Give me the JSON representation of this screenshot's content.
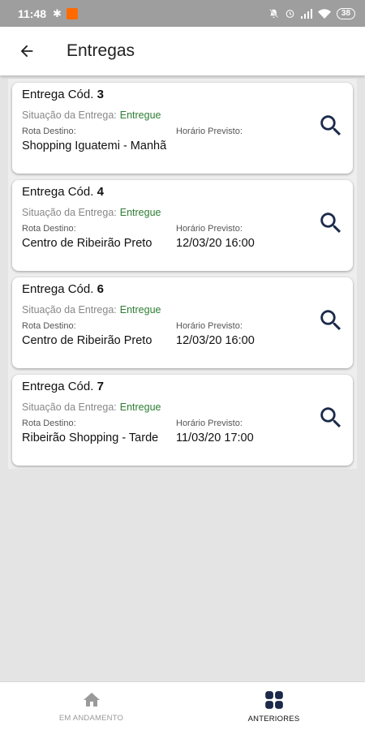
{
  "status_bar": {
    "time": "11:48",
    "bluetooth": "✱",
    "battery": "38"
  },
  "app_bar": {
    "title": "Entregas"
  },
  "deliveries": [
    {
      "title_prefix": "Entrega Cód.",
      "code": "3",
      "status_label": "Situação da Entrega:",
      "status": "Entregue",
      "route_label": "Rota Destino:",
      "route": "Shopping Iguatemi - Manhã",
      "time_label": "Horário Previsto:",
      "time": ""
    },
    {
      "title_prefix": "Entrega Cód.",
      "code": "4",
      "status_label": "Situação da Entrega:",
      "status": "Entregue",
      "route_label": "Rota Destino:",
      "route": "Centro de Ribeirão Preto",
      "time_label": "Horário Previsto:",
      "time": "12/03/20 16:00"
    },
    {
      "title_prefix": "Entrega Cód.",
      "code": "6",
      "status_label": "Situação da Entrega:",
      "status": "Entregue",
      "route_label": "Rota Destino:",
      "route": "Centro de Ribeirão Preto",
      "time_label": "Horário Previsto:",
      "time": "12/03/20 16:00"
    },
    {
      "title_prefix": "Entrega Cód.",
      "code": "7",
      "status_label": "Situação da Entrega:",
      "status": "Entregue",
      "route_label": "Rota Destino:",
      "route": "Ribeirão Shopping - Tarde",
      "time_label": "Horário Previsto:",
      "time": "11/03/20 17:00"
    }
  ],
  "bottom_nav": {
    "items": [
      {
        "label": "EM ANDAMENTO",
        "icon": "home-icon",
        "active": false
      },
      {
        "label": "ANTERIORES",
        "icon": "grid-icon",
        "active": true
      }
    ]
  },
  "colors": {
    "status_bar": "#9e9e9e",
    "status_green": "#2e7d32",
    "icon_navy": "#1b2a4a",
    "notification": "#ff6a00"
  }
}
